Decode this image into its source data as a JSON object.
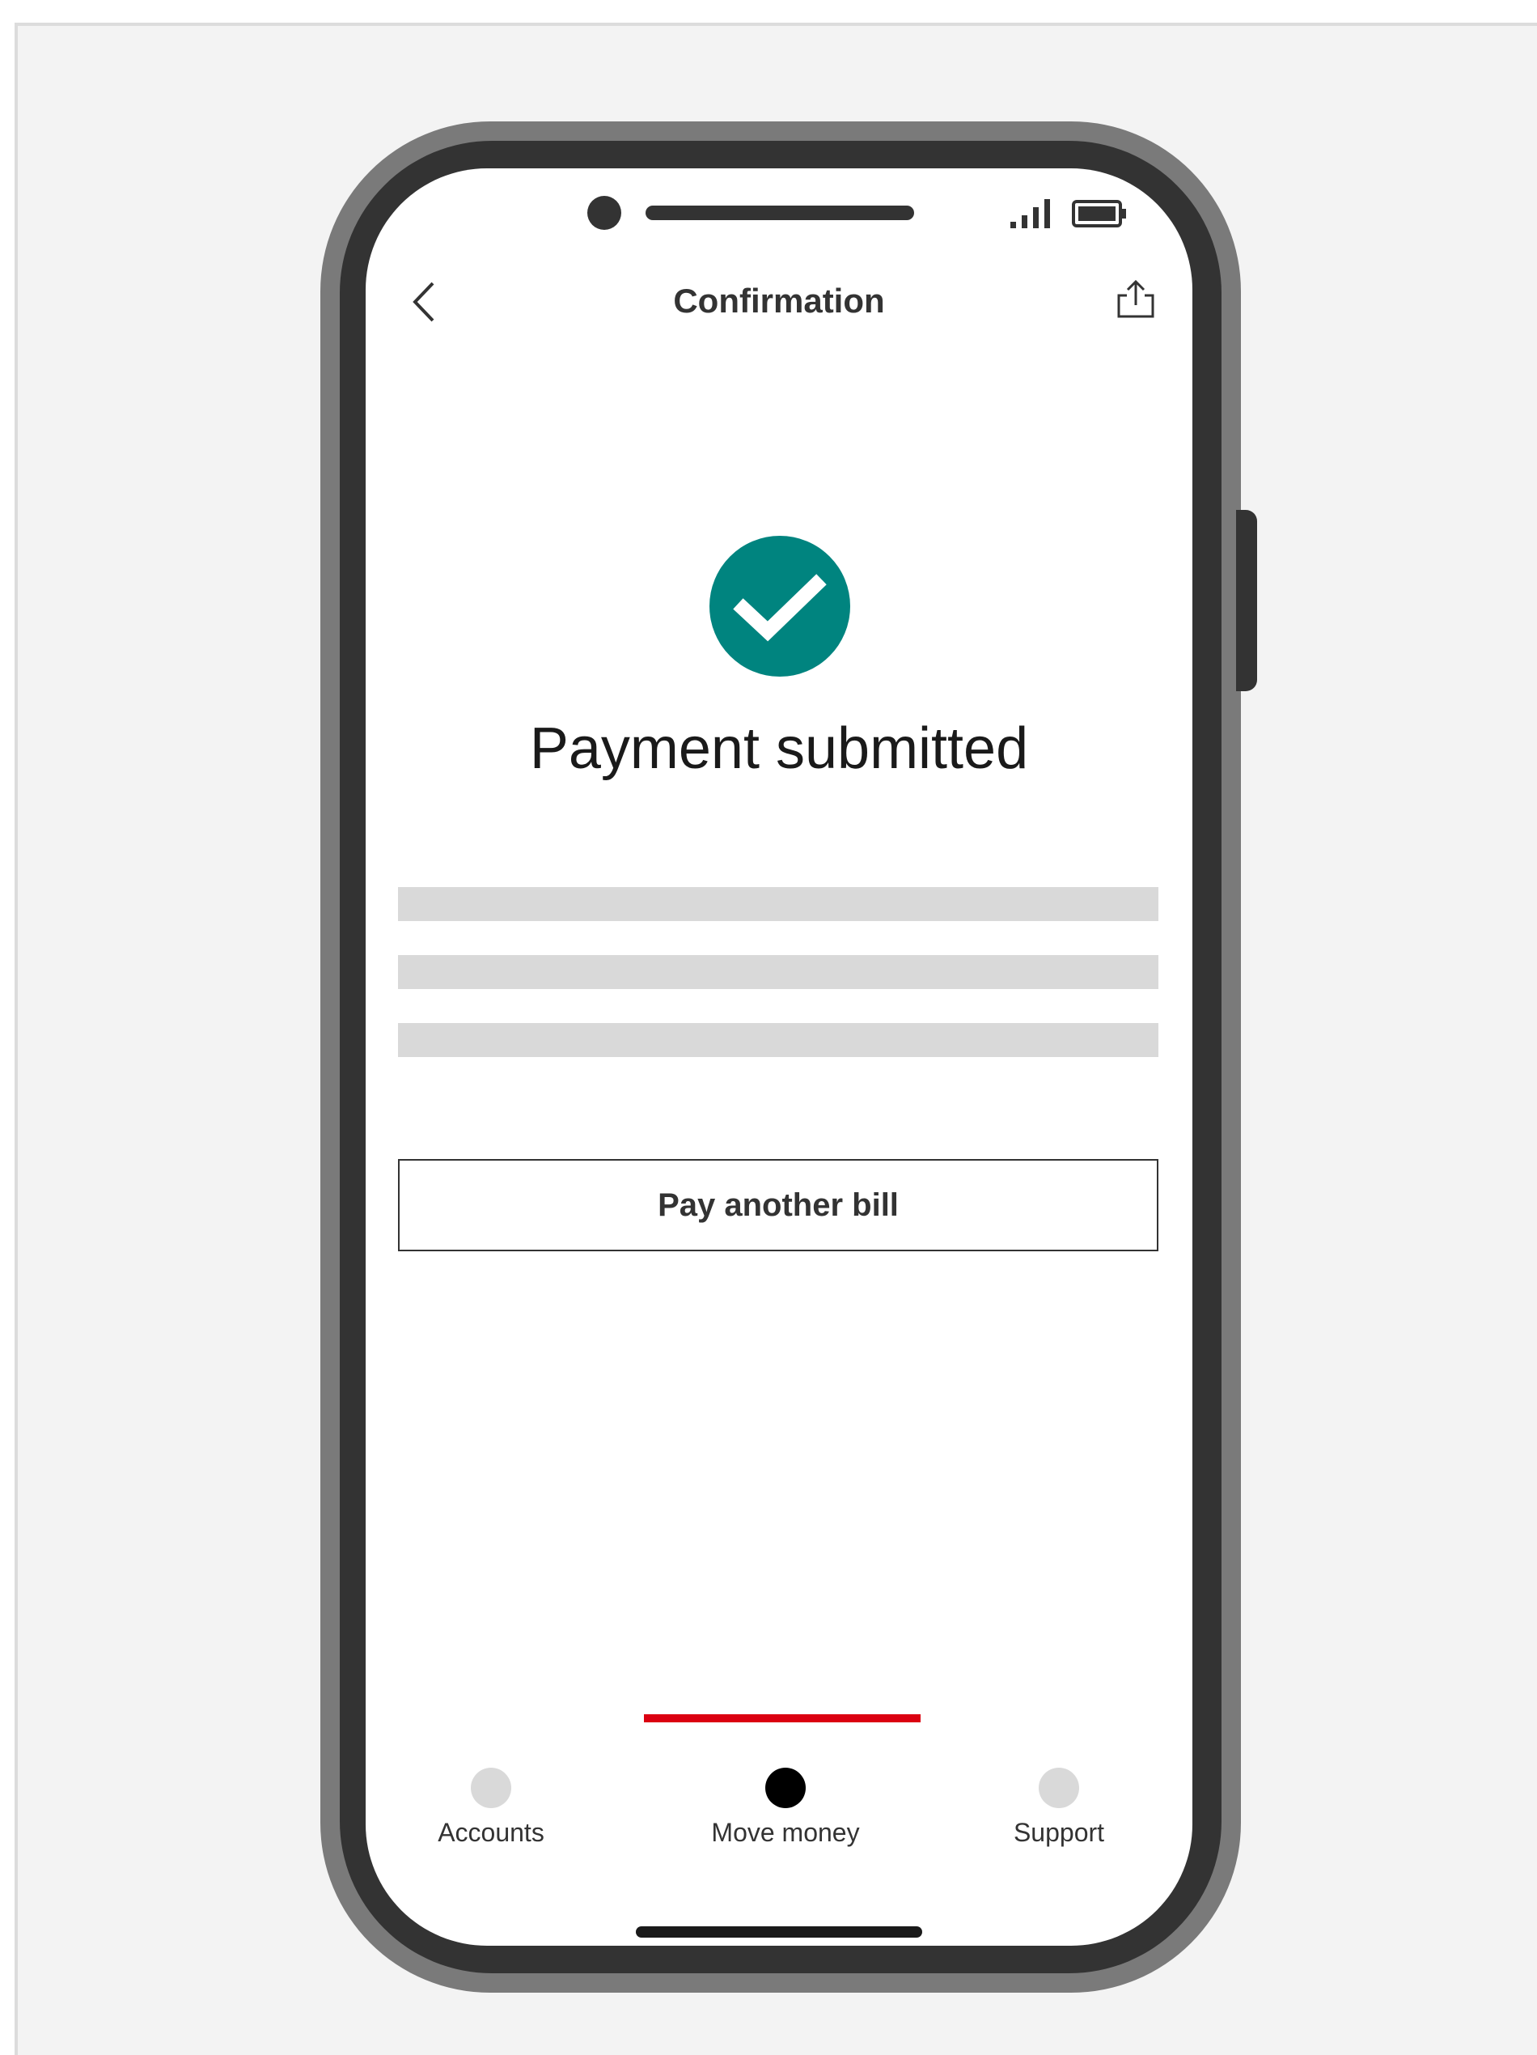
{
  "header": {
    "title": "Confirmation",
    "back_icon": "chevron-left-icon",
    "share_icon": "share-icon"
  },
  "status_bar": {
    "signal_icon": "signal-icon",
    "battery_icon": "battery-icon"
  },
  "confirmation": {
    "icon": "check-circle-icon",
    "icon_color": "#00847f",
    "title": "Payment submitted",
    "pay_another_label": "Pay another bill"
  },
  "bottom_nav": {
    "active_color": "#db0011",
    "items": [
      {
        "label": "Accounts",
        "active": false
      },
      {
        "label": "Move money",
        "active": true
      },
      {
        "label": "Support",
        "active": false
      }
    ]
  }
}
